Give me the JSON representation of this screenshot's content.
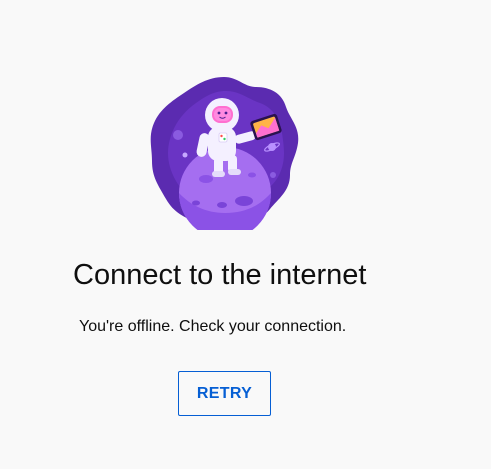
{
  "offline": {
    "title": "Connect to the internet",
    "message": "You're offline. Check your connection.",
    "retry_label": "RETRY",
    "illustration_icon": "astronaut-on-planet-icon"
  },
  "colors": {
    "background": "#f9f9f9",
    "text": "#0f0f0f",
    "accent": "#065fd4",
    "illustration_dark": "#5b2bb0",
    "illustration_mid": "#7b44d6",
    "planet": "#a56ef0"
  }
}
